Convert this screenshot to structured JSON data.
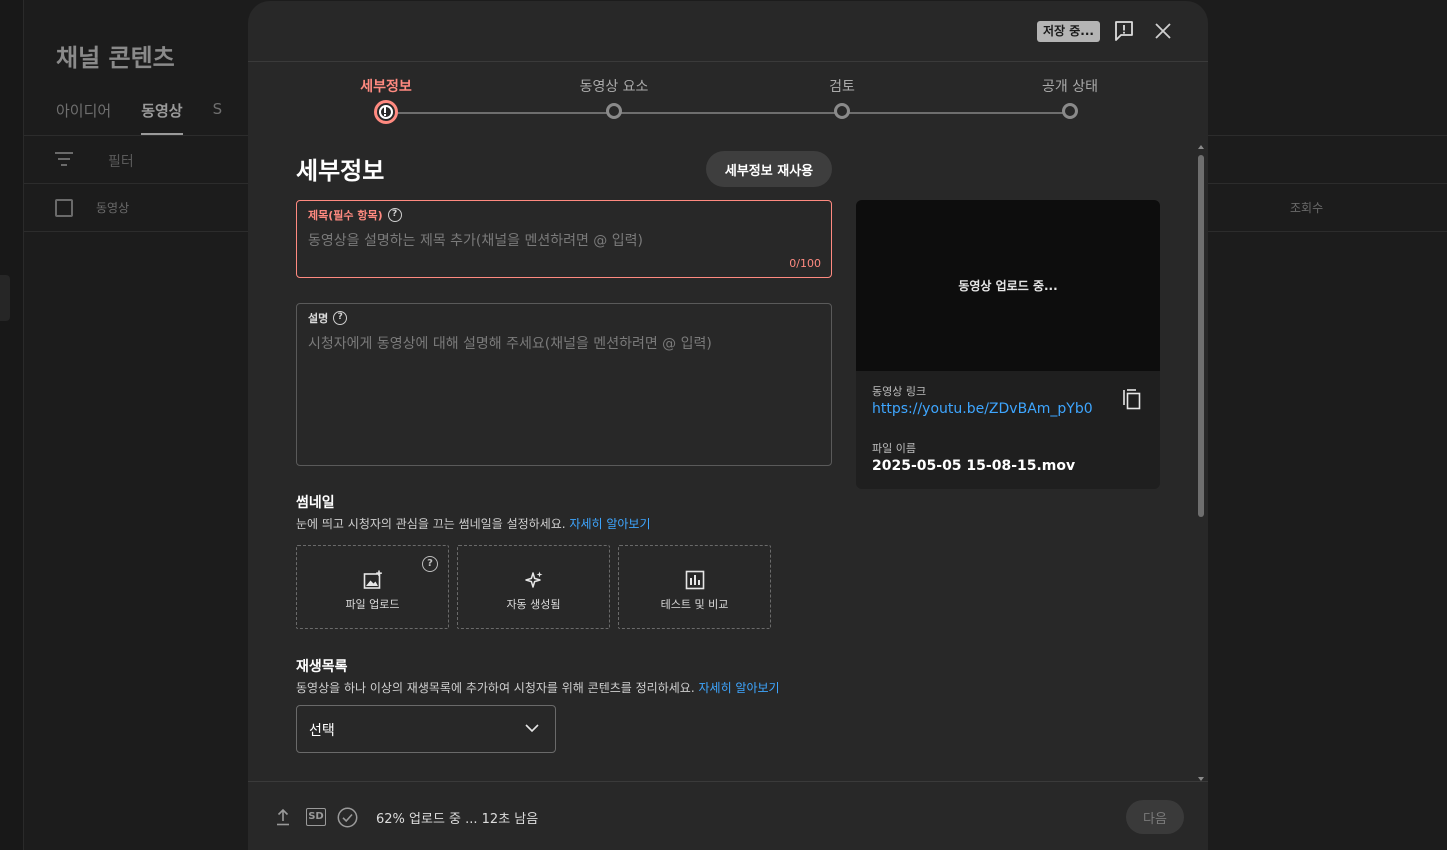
{
  "background": {
    "title": "채널 콘텐츠",
    "tabs": [
      {
        "label": "아이디어",
        "active": false
      },
      {
        "label": "동영상",
        "active": true
      },
      {
        "label": "S",
        "active": false
      }
    ],
    "filter_label": "필터",
    "columns": {
      "video": "동영상",
      "views": "조회수"
    }
  },
  "header": {
    "saving_badge": "저장 중...",
    "report_icon": "report-icon",
    "close_icon": "close-icon"
  },
  "stepper": {
    "steps": [
      {
        "label": "세부정보",
        "state": "error"
      },
      {
        "label": "동영상 요소",
        "state": "pending"
      },
      {
        "label": "검토",
        "state": "pending"
      },
      {
        "label": "공개 상태",
        "state": "pending"
      }
    ]
  },
  "details": {
    "section_title": "세부정보",
    "reuse_button": "세부정보 재사용",
    "title_field": {
      "label": "제목(필수 항목)",
      "placeholder": "동영상을 설명하는 제목 추가(채널을 멘션하려면 @ 입력)",
      "char_count": "0/100"
    },
    "description_field": {
      "label": "설명",
      "placeholder": "시청자에게 동영상에 대해 설명해 주세요(채널을 멘션하려면 @ 입력)"
    },
    "thumbnail": {
      "title": "썸네일",
      "description": "눈에 띄고 시청자의 관심을 끄는 썸네일을 설정하세요.",
      "learn_more": "자세히 알아보기",
      "options": [
        {
          "label": "파일 업로드",
          "icon": "image-upload-icon"
        },
        {
          "label": "자동 생성됨",
          "icon": "sparkle-icon"
        },
        {
          "label": "테스트 및 비교",
          "icon": "bar-chart-icon"
        }
      ]
    },
    "playlist": {
      "title": "재생목록",
      "description": "동영상을 하나 이상의 재생목록에 추가하여 시청자를 위해 콘텐츠를 정리하세요.",
      "learn_more": "자세히 알아보기",
      "select_value": "선택"
    }
  },
  "preview": {
    "status": "동영상 업로드 중...",
    "link_label": "동영상 링크",
    "link": "https://youtu.be/ZDvBAm_pYb0",
    "file_label": "파일 이름",
    "file_name": "2025-05-05 15-08-15.mov"
  },
  "footer": {
    "sd_badge": "SD",
    "progress_text": "62% 업로드 중 ... 12초 남음",
    "upload_progress_percent": 62,
    "next_button": "다음"
  },
  "colors": {
    "error_accent": "#ff8a80",
    "link": "#3ea6ff",
    "modal_bg": "#282828"
  }
}
